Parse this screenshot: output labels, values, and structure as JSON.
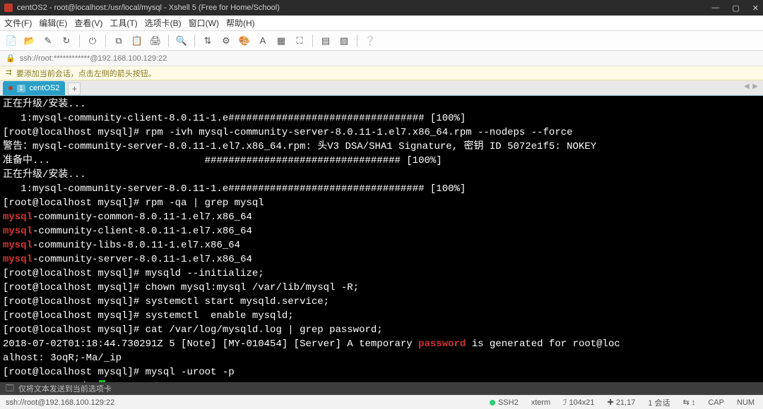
{
  "window": {
    "title": "centOS2 - root@localhost:/usr/local/mysql - Xshell 5 (Free for Home/School)"
  },
  "menu": {
    "file": "文件(F)",
    "edit": "编辑(E)",
    "view": "查看(V)",
    "tools": "工具(T)",
    "tabs": "选项卡(B)",
    "window": "窗口(W)",
    "help": "帮助(H)"
  },
  "address": {
    "text": "ssh://root:************@192.168.100.129:22"
  },
  "hint": {
    "text": "要添加当前会话，点击左侧的箭头按钮。"
  },
  "tab": {
    "num": "1",
    "label": "centOS2"
  },
  "tabrow_right": "◀  ▶",
  "terminal_lines": [
    {
      "segments": [
        {
          "t": "正在升级/安装..."
        }
      ]
    },
    {
      "segments": [
        {
          "t": "   1:mysql-community-client-8.0.11-1.e################################# [100%]"
        }
      ]
    },
    {
      "segments": [
        {
          "t": "[root@localhost mysql]# rpm -ivh mysql-community-server-8.0.11-1.el7.x86_64.rpm --nodeps --force"
        }
      ]
    },
    {
      "segments": [
        {
          "t": "警告：mysql-community-server-8.0.11-1.el7.x86_64.rpm: 头V3 DSA/SHA1 Signature, 密钥 ID 5072e1f5: NOKEY"
        }
      ]
    },
    {
      "segments": [
        {
          "t": "准备中...                          ################################# [100%]"
        }
      ]
    },
    {
      "segments": [
        {
          "t": "正在升级/安装..."
        }
      ]
    },
    {
      "segments": [
        {
          "t": "   1:mysql-community-server-8.0.11-1.e################################# [100%]"
        }
      ]
    },
    {
      "segments": [
        {
          "t": "[root@localhost mysql]# rpm -qa | grep mysql"
        }
      ]
    },
    {
      "segments": [
        {
          "t": "mysql",
          "c": "red"
        },
        {
          "t": "-community-common-8.0.11-1.el7.x86_64"
        }
      ]
    },
    {
      "segments": [
        {
          "t": "mysql",
          "c": "red"
        },
        {
          "t": "-community-client-8.0.11-1.el7.x86_64"
        }
      ]
    },
    {
      "segments": [
        {
          "t": "mysql",
          "c": "red"
        },
        {
          "t": "-community-libs-8.0.11-1.el7.x86_64"
        }
      ]
    },
    {
      "segments": [
        {
          "t": "mysql",
          "c": "red"
        },
        {
          "t": "-community-server-8.0.11-1.el7.x86_64"
        }
      ]
    },
    {
      "segments": [
        {
          "t": "[root@localhost mysql]# mysqld --initialize;"
        }
      ]
    },
    {
      "segments": [
        {
          "t": "[root@localhost mysql]# chown mysql:mysql /var/lib/mysql -R;"
        }
      ]
    },
    {
      "segments": [
        {
          "t": "[root@localhost mysql]# systemctl start mysqld.service;"
        }
      ]
    },
    {
      "segments": [
        {
          "t": "[root@localhost mysql]# systemctl  enable mysqld;"
        }
      ]
    },
    {
      "segments": [
        {
          "t": "[root@localhost mysql]# cat /var/log/mysqld.log | grep password;"
        }
      ]
    },
    {
      "segments": [
        {
          "t": "2018-07-02T01:18:44.730291Z 5 [Note] [MY-010454] [Server] A temporary "
        },
        {
          "t": "password",
          "c": "red"
        },
        {
          "t": " is generated for root@loc"
        }
      ]
    },
    {
      "segments": [
        {
          "t": "alhost: 3oqR;-Ma/_ip"
        }
      ]
    },
    {
      "segments": [
        {
          "t": "[root@localhost mysql]# mysql -uroot -p"
        }
      ]
    },
    {
      "segments": [
        {
          "t": "Enter password: "
        }
      ],
      "cursor": true
    }
  ],
  "footerstrip": {
    "text": "仅将文本发送到当前选项卡"
  },
  "status": {
    "left": "ssh://root@192.168.100.129:22",
    "ssh": "SSH2",
    "term": "xterm",
    "size": "104x21",
    "cursor": "21,17",
    "sessions": "1 会话",
    "extra": "⇆ ↕",
    "cap": "CAP",
    "num": "NUM"
  }
}
